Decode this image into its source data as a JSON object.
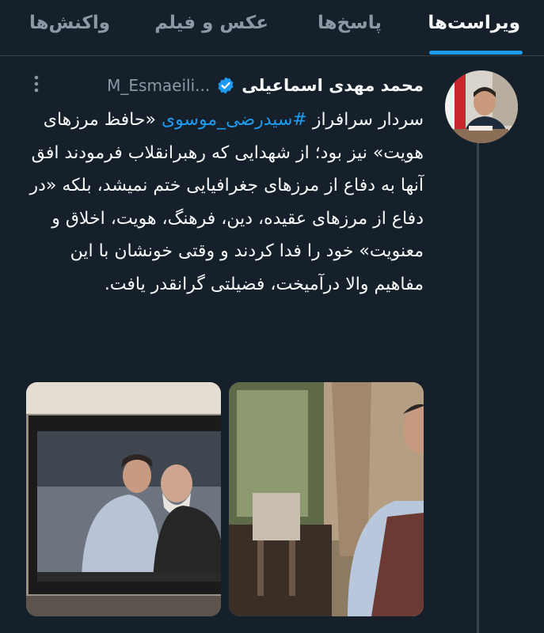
{
  "tabs": [
    {
      "label": "ویراست‌ها",
      "active": true
    },
    {
      "label": "پاسخ‌ها",
      "active": false
    },
    {
      "label": "عکس و فیلم",
      "active": false
    },
    {
      "label": "واکنش‌ها",
      "active": false
    }
  ],
  "tweet": {
    "author_name": "محمد مهدی اسماعیلی",
    "verified": true,
    "handle": "M_Esmaeili...",
    "text_before_hashtag": "سردار سرافراز ",
    "hashtag": "#سیدرضی_موسوی",
    "text_after_hashtag": " «حافظ مرزهای هویت» نیز بود؛ از شهدایی که رهبرانقلاب فرمودند افق آنها به دفاع از مرزهای جغرافیایی ختم نمیشد، بلکه «در دفاع از مرزهای عقیده، دین، فرهنگ، هویت، اخلاق و معنویت» خود را فدا کردند و وقتی خونشان با این مفاهیم والا درآمیخت، فضیلتی گرانقدر یافت.",
    "media": [
      {
        "name": "photo-framed-portrait"
      },
      {
        "name": "photo-man-in-vest"
      }
    ]
  },
  "colors": {
    "background": "#15202b",
    "accent": "#1d9bf0",
    "muted": "#8b98a5",
    "divider": "#38444d"
  },
  "icons": {
    "verified": "verified-badge-icon",
    "more": "more-options-icon"
  }
}
